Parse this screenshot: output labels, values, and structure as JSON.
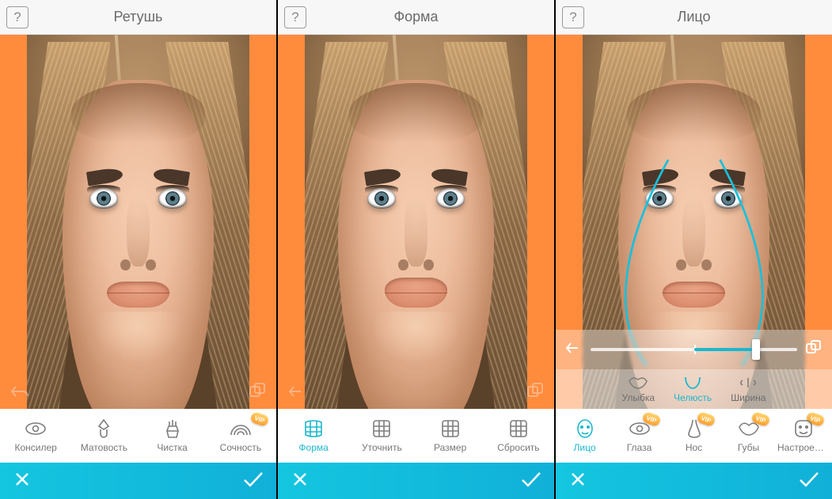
{
  "vip_label": "VIP",
  "screens": [
    {
      "title": "Ретушь",
      "tools": [
        {
          "label": "Консилер",
          "icon": "eye",
          "vip": false,
          "active": false
        },
        {
          "label": "Матовость",
          "icon": "brush",
          "vip": false,
          "active": false
        },
        {
          "label": "Чистка",
          "icon": "broom",
          "vip": false,
          "active": false
        },
        {
          "label": "Сочность",
          "icon": "rainbow",
          "vip": true,
          "active": false
        }
      ]
    },
    {
      "title": "Форма",
      "tools": [
        {
          "label": "Форма",
          "icon": "grid-warp",
          "vip": false,
          "active": true
        },
        {
          "label": "Уточнить",
          "icon": "grid",
          "vip": false,
          "active": false
        },
        {
          "label": "Размер",
          "icon": "grid",
          "vip": false,
          "active": false
        },
        {
          "label": "Сбросить",
          "icon": "grid",
          "vip": false,
          "active": false
        }
      ]
    },
    {
      "title": "Лицо",
      "slider": {
        "min": -50,
        "max": 50,
        "value": 25
      },
      "sub_tools": [
        {
          "label": "Улыбка",
          "icon": "lips",
          "active": false
        },
        {
          "label": "Челюсть",
          "icon": "jaw",
          "active": true
        },
        {
          "label": "Ширина",
          "icon": "width",
          "active": false
        }
      ],
      "tools": [
        {
          "label": "Лицо",
          "icon": "face",
          "vip": false,
          "active": true
        },
        {
          "label": "Глаза",
          "icon": "eye",
          "vip": true,
          "active": false
        },
        {
          "label": "Нос",
          "icon": "nose",
          "vip": true,
          "active": false
        },
        {
          "label": "Губы",
          "icon": "lips",
          "vip": true,
          "active": false
        },
        {
          "label": "Настроение",
          "icon": "mood",
          "vip": true,
          "active": false
        }
      ]
    }
  ]
}
